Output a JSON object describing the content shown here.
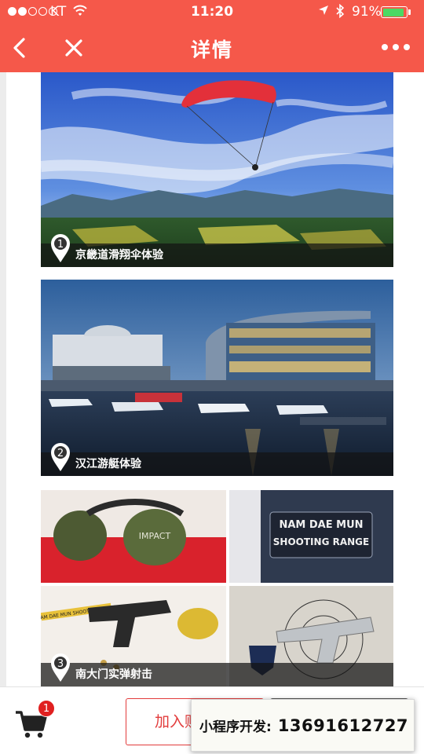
{
  "status_bar": {
    "carrier": "KT",
    "time": "11:20",
    "battery_percent": "91%",
    "battery_level": 0.91
  },
  "nav": {
    "title": "详情"
  },
  "cards": [
    {
      "number": "1",
      "caption": "京畿道滑翔伞体验"
    },
    {
      "number": "2",
      "caption": "汉江游艇体验"
    },
    {
      "number": "3",
      "caption": "南大门实弹射击",
      "signs": {
        "patch_line1": "NAM DAE MUN",
        "patch_line2": "SHOOTING RANGE",
        "small_text": "NAM DAE MUN SHOOTING RANGE",
        "earmuff_brand": "IMPACT"
      }
    }
  ],
  "bottom_bar": {
    "cart_count": "1",
    "add_to_cart_label": "加入购"
  },
  "watermark": {
    "label": "小程序开发:",
    "phone": "13691612727"
  },
  "colors": {
    "header_bg": "#f5584a",
    "accent": "#e23b3b",
    "badge": "#e02020",
    "battery_fill": "#4cd964"
  },
  "icons": [
    "wifi-icon",
    "location-arrow-icon",
    "bluetooth-icon",
    "battery-icon",
    "back-icon",
    "close-icon",
    "more-icon",
    "map-pin-icon",
    "cart-icon"
  ]
}
